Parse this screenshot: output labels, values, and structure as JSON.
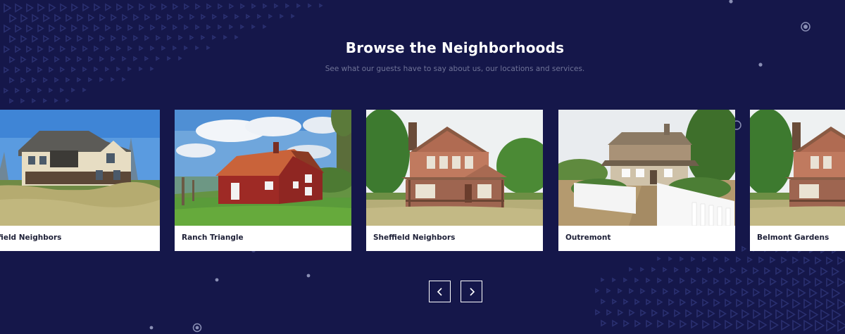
{
  "section": {
    "title": "Browse the Neighborhoods",
    "subtitle": "See what our guests have to say about us, our locations and services."
  },
  "neighborhoods": [
    {
      "label": "Sheffield Neighbors",
      "visible_text": "effield Neighbors",
      "image": "two-story-house-photo"
    },
    {
      "label": "Ranch Triangle",
      "image": "red-barn-house-photo"
    },
    {
      "label": "Sheffield Neighbors",
      "image": "brick-house-porch-photo"
    },
    {
      "label": "Outremont",
      "image": "cabin-white-fence-photo"
    },
    {
      "label": "Belmont Gardens",
      "image": "brick-house-porch-photo"
    }
  ],
  "navigation": {
    "prev_icon": "chevron-left-icon",
    "next_icon": "chevron-right-icon"
  },
  "colors": {
    "background": "#15174a",
    "card": "#ffffff",
    "title": "#ffffff",
    "subtitle": "#6f7397",
    "pattern": "#2c3272"
  }
}
